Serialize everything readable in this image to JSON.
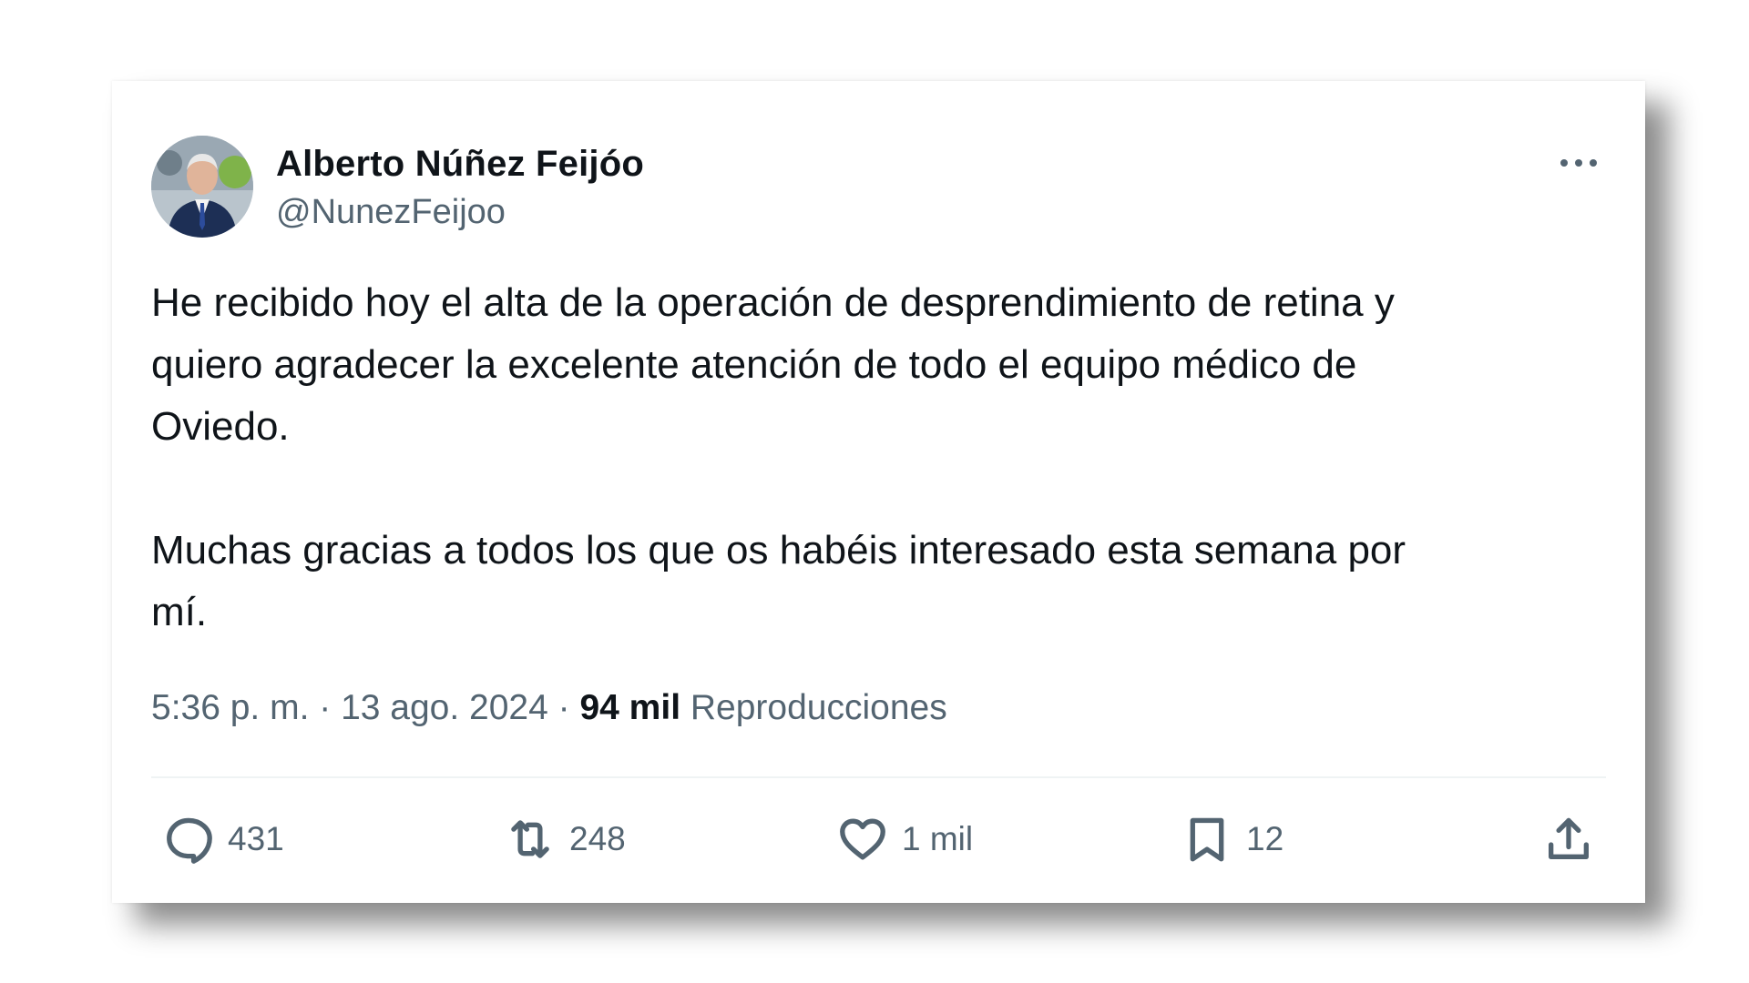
{
  "tweet": {
    "author": {
      "display_name": "Alberto Núñez Feijóo",
      "handle": "@NunezFeijoo",
      "avatar_icon": "user-avatar-photo"
    },
    "more_icon": "more-horizontal-icon",
    "body_paragraphs": [
      "He recibido hoy el alta de la operación de desprendimiento de retina y\nquiero agradecer la excelente atención de todo el equipo médico de\nOviedo.",
      "Muchas gracias a todos los que os habéis interesado esta semana por\nmí."
    ],
    "timestamp": "5:36 p. m. · 13 ago. 2024 · ",
    "views_count": "94 mil",
    "views_label": " Reproducciones",
    "actions": {
      "reply": {
        "icon": "reply-icon",
        "count": "431"
      },
      "retweet": {
        "icon": "retweet-icon",
        "count": "248"
      },
      "like": {
        "icon": "heart-icon",
        "count": "1 mil"
      },
      "bookmark": {
        "icon": "bookmark-icon",
        "count": "12"
      },
      "share": {
        "icon": "share-icon"
      }
    }
  },
  "colors": {
    "text_primary": "#0f1419",
    "text_secondary": "#536471",
    "divider": "#eff3f4"
  }
}
